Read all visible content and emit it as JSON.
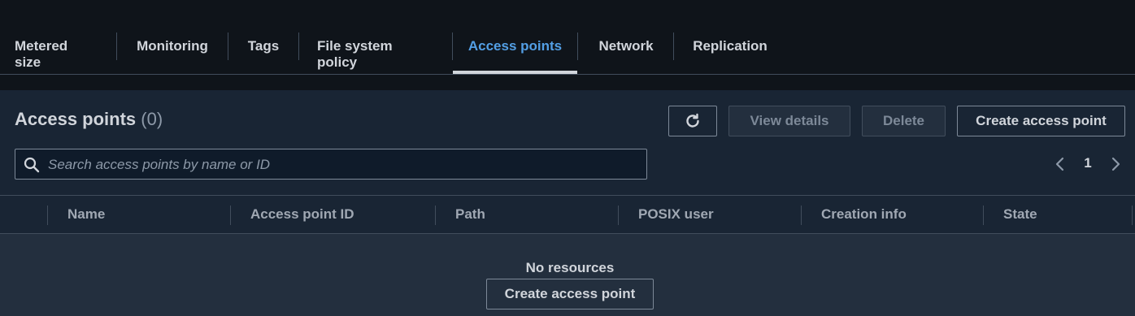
{
  "tabs": [
    {
      "label": "Metered size",
      "active": false
    },
    {
      "label": "Monitoring",
      "active": false
    },
    {
      "label": "Tags",
      "active": false
    },
    {
      "label": "File system policy",
      "active": false
    },
    {
      "label": "Access points",
      "active": true
    },
    {
      "label": "Network",
      "active": false
    },
    {
      "label": "Replication",
      "active": false
    }
  ],
  "section": {
    "title": "Access points",
    "count": "(0)"
  },
  "actions": {
    "refresh_icon": "refresh-icon",
    "view_details": "View details",
    "delete": "Delete",
    "create": "Create access point"
  },
  "search": {
    "placeholder": "Search access points by name or ID",
    "value": ""
  },
  "pagination": {
    "current_page": "1"
  },
  "table": {
    "columns": [
      "Name",
      "Access point ID",
      "Path",
      "POSIX user",
      "Creation info",
      "State"
    ],
    "rows": []
  },
  "empty_state": {
    "title": "No resources",
    "button": "Create access point"
  },
  "colors": {
    "accent": "#539fe5",
    "background": "#0f141a",
    "panel": "#192534"
  }
}
